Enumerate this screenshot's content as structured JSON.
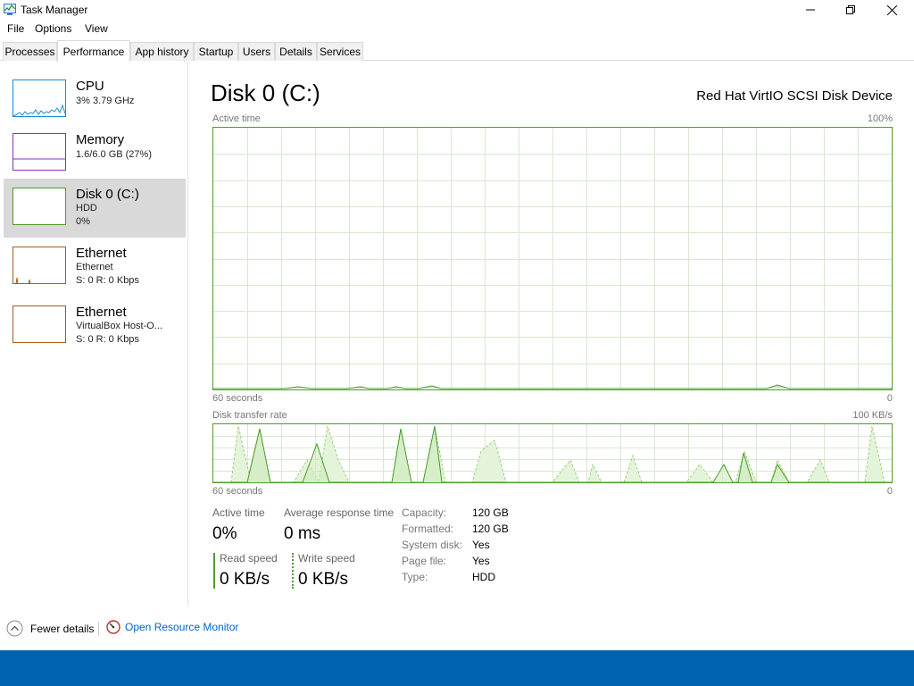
{
  "window": {
    "title": "Task Manager"
  },
  "menu": [
    "File",
    "Options",
    "View"
  ],
  "tabs": [
    "Processes",
    "Performance",
    "App history",
    "Startup",
    "Users",
    "Details",
    "Services"
  ],
  "sidebar": [
    {
      "title": "CPU",
      "sub1": "3%  3.79 GHz",
      "sub2": ""
    },
    {
      "title": "Memory",
      "sub1": "1.6/6.0 GB (27%)",
      "sub2": ""
    },
    {
      "title": "Disk 0 (C:)",
      "sub1": "HDD",
      "sub2": "0%"
    },
    {
      "title": "Ethernet",
      "sub1": "Ethernet",
      "sub2": "S: 0  R: 0 Kbps"
    },
    {
      "title": "Ethernet",
      "sub1": "VirtualBox Host-O...",
      "sub2": "S: 0  R: 0 Kbps"
    }
  ],
  "main": {
    "title": "Disk 0 (C:)",
    "device": "Red Hat VirtIO SCSI Disk Device",
    "graph1": {
      "label": "Active time",
      "max": "100%",
      "time": "60 seconds",
      "min": "0"
    },
    "graph2": {
      "label": "Disk transfer rate",
      "max": "100 KB/s",
      "time": "60 seconds",
      "min": "0"
    },
    "stats": {
      "active_time_label": "Active time",
      "active_time_value": "0%",
      "avg_response_label": "Average response time",
      "avg_response_value": "0 ms",
      "read_label": "Read speed",
      "read_value": "0 KB/s",
      "write_label": "Write speed",
      "write_value": "0 KB/s"
    },
    "properties": [
      {
        "label": "Capacity:",
        "value": "120 GB"
      },
      {
        "label": "Formatted:",
        "value": "120 GB"
      },
      {
        "label": "System disk:",
        "value": "Yes"
      },
      {
        "label": "Page file:",
        "value": "Yes"
      },
      {
        "label": "Type:",
        "value": "HDD"
      }
    ]
  },
  "footer": {
    "fewer_details": "Fewer details",
    "open_resource_monitor": "Open Resource Monitor"
  },
  "colors": {
    "cpu": "#1b8ad6",
    "memory": "#8b2fbf",
    "disk": "#4e9a2c",
    "ethernet": "#a75d1a",
    "link": "#0066cc",
    "taskbar": "#0063b1"
  }
}
